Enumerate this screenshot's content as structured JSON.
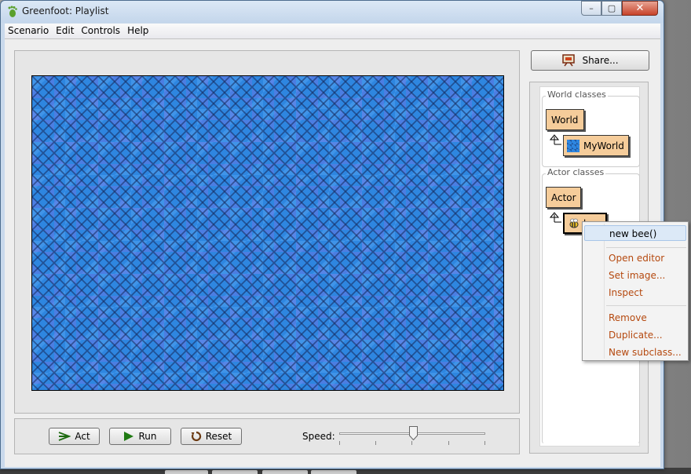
{
  "window": {
    "title": "Greenfoot: Playlist",
    "minimize_glyph": "–",
    "maximize_glyph": "▢",
    "close_glyph": "✕"
  },
  "menubar": {
    "items": [
      "Scenario",
      "Edit",
      "Controls",
      "Help"
    ]
  },
  "controls": {
    "act_label": "Act",
    "run_label": "Run",
    "reset_label": "Reset",
    "speed_label": "Speed:",
    "speed_value_percent": 50
  },
  "share": {
    "label": "Share..."
  },
  "classes": {
    "world_title": "World classes",
    "world_root": "World",
    "world_sub": "MyWorld",
    "actor_title": "Actor classes",
    "actor_root": "Actor",
    "actor_sub": "bee"
  },
  "context_menu": {
    "items": [
      "new bee()",
      "Open editor",
      "Set image...",
      "Inspect",
      "Remove",
      "Duplicate...",
      "New subclass..."
    ]
  },
  "colors": {
    "class_box": "#f5cc9a",
    "world_background": "#2e86e0",
    "menu_highlight": "#dce9f7",
    "menu_orange_text": "#b5490f"
  },
  "icons": {
    "app": "greenfoot-foot-icon",
    "act": "step-arrow-icon",
    "run": "play-icon",
    "reset": "reset-icon",
    "share": "easel-icon",
    "myworld": "blue-tile-icon",
    "bee": "bee-icon",
    "inherit": "inheritance-arrow-icon"
  }
}
